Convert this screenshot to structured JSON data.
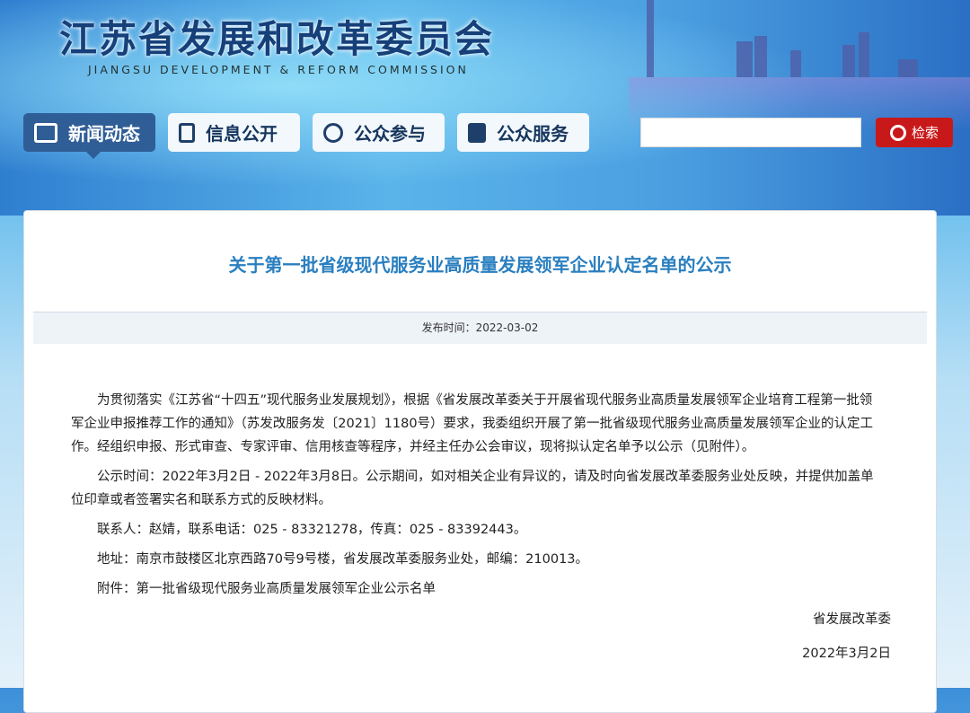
{
  "header": {
    "title_cn": "江苏省发展和改革委员会",
    "title_en": "JIANGSU DEVELOPMENT & REFORM COMMISSION"
  },
  "nav": [
    {
      "label": "新闻动态",
      "icon": "news-icon"
    },
    {
      "label": "信息公开",
      "icon": "document-icon"
    },
    {
      "label": "公众参与",
      "icon": "chat-icon"
    },
    {
      "label": "公众服务",
      "icon": "book-icon"
    }
  ],
  "search": {
    "value": "",
    "button": "检索"
  },
  "article": {
    "title": "关于第一批省级现代服务业高质量发展领军企业认定名单的公示",
    "publish": "发布时间：2022-03-02",
    "paragraphs": [
      "为贯彻落实《江苏省“十四五”现代服务业发展规划》，根据《省发展改革委关于开展省现代服务业高质量发展领军企业培育工程第一批领军企业申报推荐工作的通知》（苏发改服务发〔2021〕1180号）要求，我委组织开展了第一批省级现代服务业高质量发展领军企业的认定工作。经组织申报、形式审查、专家评审、信用核查等程序，并经主任办公会审议，现将拟认定名单予以公示（见附件）。",
      "公示时间：2022年3月2日 - 2022年3月8日。公示期间，如对相关企业有异议的，请及时向省发展改革委服务业处反映，并提供加盖单位印章或者签署实名和联系方式的反映材料。",
      "联系人：赵婧，联系电话：025 - 83321278，传真：025 - 83392443。",
      "地址：南京市鼓楼区北京西路70号9号楼，省发展改革委服务业处，邮编：210013。",
      "附件：第一批省级现代服务业高质量发展领军企业公示名单"
    ],
    "signer": "省发展改革委",
    "date": "2022年3月2日"
  }
}
